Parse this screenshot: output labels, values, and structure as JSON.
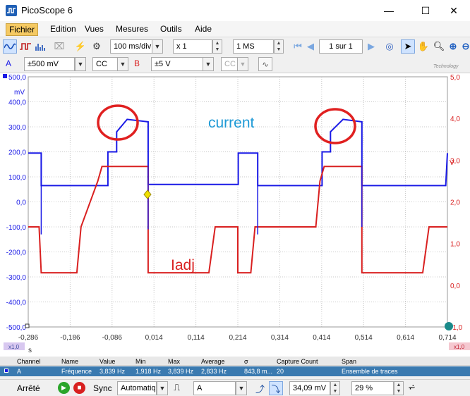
{
  "window": {
    "title": "PicoScope 6",
    "minimize": "—",
    "maximize": "☐",
    "close": "✕"
  },
  "menu": [
    "Fichier",
    "Edition",
    "Vues",
    "Mesures",
    "Outils",
    "Aide"
  ],
  "toolbar": {
    "timebase": "100 ms/div",
    "multiplier": "x 1",
    "samples": "1 MS",
    "buffer": "1 sur 1",
    "logo": "Technology"
  },
  "channels": {
    "a": {
      "label": "A",
      "range": "±500 mV",
      "coupling": "CC",
      "color": "#1a1ae6"
    },
    "b": {
      "label": "B",
      "range": "±5 V",
      "coupling": "CC",
      "color": "#d92020"
    }
  },
  "axes": {
    "left_unit": "mV",
    "left_ticks": [
      "500,0",
      "400,0",
      "300,0",
      "200,0",
      "100,0",
      "0,0",
      "-100,0",
      "-200,0",
      "-300,0",
      "-400,0",
      "-500,0"
    ],
    "right_unit": "V",
    "right_ticks": [
      "5,0",
      "4,0",
      "3,0",
      "2,0",
      "1,0",
      "0,0",
      "-1,0"
    ],
    "x_ticks": [
      "-0,286",
      "-0,186",
      "-0,086",
      "0,014",
      "0,114",
      "0,214",
      "0,314",
      "0,414",
      "0,514",
      "0,614",
      "0,714"
    ],
    "x_unit": "s",
    "zoom_a": "x1,0",
    "zoom_b": "x1,0"
  },
  "annotations": {
    "current": "current",
    "iadj": "Iadj"
  },
  "chart_data": {
    "type": "line",
    "series": [
      {
        "name": "A",
        "unit": "mV",
        "x": [
          -0.286,
          -0.255,
          -0.255,
          -0.096,
          -0.096,
          -0.075,
          -0.075,
          -0.05,
          0.0,
          0.0,
          0.215,
          0.215,
          0.2614,
          0.2614,
          0.415,
          0.415,
          0.435,
          0.435,
          0.465,
          0.51,
          0.51,
          0.71,
          0.714
        ],
        "y": [
          195,
          195,
          65,
          65,
          200,
          200,
          280,
          330,
          320,
          70,
          70,
          195,
          195,
          65,
          65,
          200,
          200,
          280,
          330,
          320,
          65,
          65,
          195
        ]
      },
      {
        "name": "B",
        "unit": "V",
        "x": [
          -0.286,
          -0.26,
          -0.255,
          -0.17,
          -0.16,
          -0.12,
          -0.11,
          0.0,
          0.0,
          0.145,
          0.16,
          0.214,
          0.214,
          0.245,
          0.255,
          0.4,
          0.41,
          0.42,
          0.435,
          0.51,
          0.51,
          0.655,
          0.67,
          0.71,
          0.714
        ],
        "y": [
          1.4,
          1.4,
          0.3,
          0.3,
          1.4,
          2.5,
          2.85,
          2.85,
          0.3,
          0.3,
          1.4,
          1.4,
          0.3,
          0.3,
          1.4,
          1.4,
          2.5,
          2.85,
          2.85,
          2.85,
          0.3,
          0.3,
          1.4,
          1.4,
          1.4
        ]
      }
    ],
    "xlim": [
      -0.286,
      0.714
    ],
    "ylim": [
      -500,
      500
    ],
    "y2lim": [
      -1,
      5
    ],
    "grid": true
  },
  "measurements": {
    "headers": [
      "Channel",
      "Name",
      "Value",
      "Min",
      "Max",
      "Average",
      "σ",
      "Capture Count",
      "Span"
    ],
    "row": [
      "A",
      "Fréquence",
      "3,839 Hz",
      "1,918 Hz",
      "3,839 Hz",
      "2,833 Hz",
      "843,8 m...",
      "20",
      "Ensemble de traces"
    ]
  },
  "status": {
    "state": "Arrêté",
    "sync": "Sync",
    "trigger_mode": "Automatiq",
    "trigger_source": "A",
    "trigger_level": "34,09 mV",
    "pretrigger": "29 %"
  }
}
